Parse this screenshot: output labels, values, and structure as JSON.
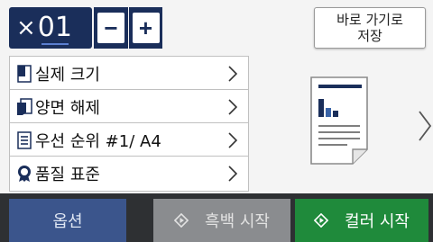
{
  "copies": {
    "prefix": "×",
    "count": "01",
    "minus_label": "−",
    "plus_label": "+"
  },
  "shortcut": {
    "label": "바로 가기로\n저장"
  },
  "settings": [
    {
      "label": "실제 크기",
      "icon": "page-size-icon"
    },
    {
      "label": "양면 해제",
      "icon": "duplex-icon"
    },
    {
      "label": "우선 순위 #1/ A4",
      "icon": "tray-icon"
    },
    {
      "label": "품질 표준",
      "icon": "quality-icon"
    }
  ],
  "bottom": {
    "options_label": "옵션",
    "mono_start_label": "흑백 시작",
    "color_start_label": "컬러 시작"
  },
  "colors": {
    "navy": "#1a2e5a",
    "options_bg": "#3b558c",
    "mono_bg": "#8a8c8f",
    "color_bg": "#1f8a3b"
  }
}
